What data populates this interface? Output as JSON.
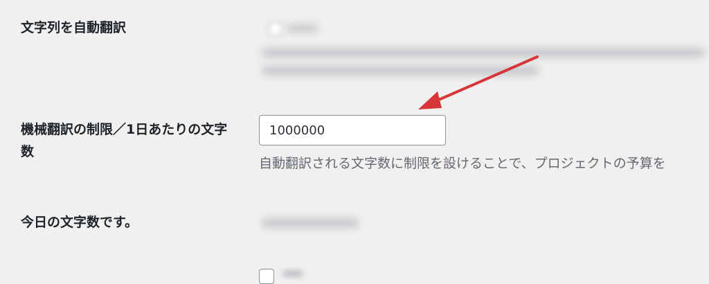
{
  "settings": {
    "auto_translate_label": "文字列を自動翻訳",
    "limit_label": "機械翻訳の制限／1日あたりの文字数",
    "limit_value": "1000000",
    "limit_description": "自動翻訳される文字数に制限を設けることで、プロジェクトの予算を",
    "today_label": "今日の文字数です。"
  },
  "colors": {
    "background": "#f0f0f1",
    "arrow": "#d63638",
    "description_text": "#646970"
  },
  "icons": {
    "annotation": "red-arrow-icon"
  }
}
